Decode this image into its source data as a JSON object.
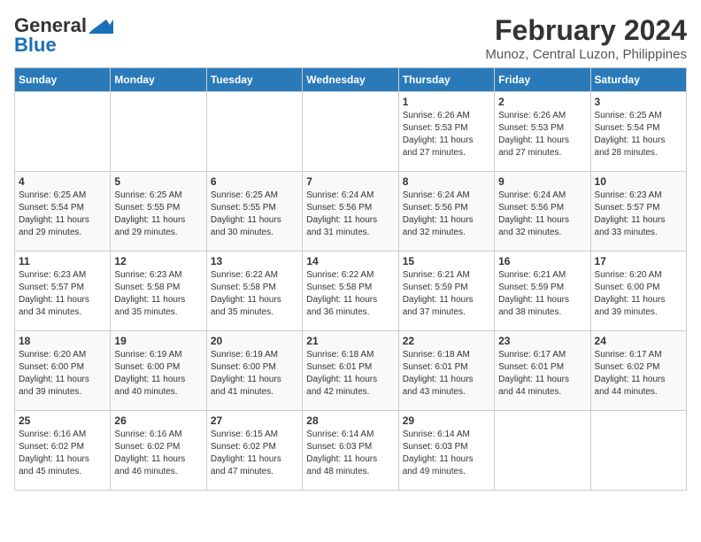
{
  "logo": {
    "line1": "General",
    "line2": "Blue"
  },
  "title": "February 2024",
  "subtitle": "Munoz, Central Luzon, Philippines",
  "days_of_week": [
    "Sunday",
    "Monday",
    "Tuesday",
    "Wednesday",
    "Thursday",
    "Friday",
    "Saturday"
  ],
  "weeks": [
    [
      {
        "day": "",
        "info": ""
      },
      {
        "day": "",
        "info": ""
      },
      {
        "day": "",
        "info": ""
      },
      {
        "day": "",
        "info": ""
      },
      {
        "day": "1",
        "info": "Sunrise: 6:26 AM\nSunset: 5:53 PM\nDaylight: 11 hours\nand 27 minutes."
      },
      {
        "day": "2",
        "info": "Sunrise: 6:26 AM\nSunset: 5:53 PM\nDaylight: 11 hours\nand 27 minutes."
      },
      {
        "day": "3",
        "info": "Sunrise: 6:25 AM\nSunset: 5:54 PM\nDaylight: 11 hours\nand 28 minutes."
      }
    ],
    [
      {
        "day": "4",
        "info": "Sunrise: 6:25 AM\nSunset: 5:54 PM\nDaylight: 11 hours\nand 29 minutes."
      },
      {
        "day": "5",
        "info": "Sunrise: 6:25 AM\nSunset: 5:55 PM\nDaylight: 11 hours\nand 29 minutes."
      },
      {
        "day": "6",
        "info": "Sunrise: 6:25 AM\nSunset: 5:55 PM\nDaylight: 11 hours\nand 30 minutes."
      },
      {
        "day": "7",
        "info": "Sunrise: 6:24 AM\nSunset: 5:56 PM\nDaylight: 11 hours\nand 31 minutes."
      },
      {
        "day": "8",
        "info": "Sunrise: 6:24 AM\nSunset: 5:56 PM\nDaylight: 11 hours\nand 32 minutes."
      },
      {
        "day": "9",
        "info": "Sunrise: 6:24 AM\nSunset: 5:56 PM\nDaylight: 11 hours\nand 32 minutes."
      },
      {
        "day": "10",
        "info": "Sunrise: 6:23 AM\nSunset: 5:57 PM\nDaylight: 11 hours\nand 33 minutes."
      }
    ],
    [
      {
        "day": "11",
        "info": "Sunrise: 6:23 AM\nSunset: 5:57 PM\nDaylight: 11 hours\nand 34 minutes."
      },
      {
        "day": "12",
        "info": "Sunrise: 6:23 AM\nSunset: 5:58 PM\nDaylight: 11 hours\nand 35 minutes."
      },
      {
        "day": "13",
        "info": "Sunrise: 6:22 AM\nSunset: 5:58 PM\nDaylight: 11 hours\nand 35 minutes."
      },
      {
        "day": "14",
        "info": "Sunrise: 6:22 AM\nSunset: 5:58 PM\nDaylight: 11 hours\nand 36 minutes."
      },
      {
        "day": "15",
        "info": "Sunrise: 6:21 AM\nSunset: 5:59 PM\nDaylight: 11 hours\nand 37 minutes."
      },
      {
        "day": "16",
        "info": "Sunrise: 6:21 AM\nSunset: 5:59 PM\nDaylight: 11 hours\nand 38 minutes."
      },
      {
        "day": "17",
        "info": "Sunrise: 6:20 AM\nSunset: 6:00 PM\nDaylight: 11 hours\nand 39 minutes."
      }
    ],
    [
      {
        "day": "18",
        "info": "Sunrise: 6:20 AM\nSunset: 6:00 PM\nDaylight: 11 hours\nand 39 minutes."
      },
      {
        "day": "19",
        "info": "Sunrise: 6:19 AM\nSunset: 6:00 PM\nDaylight: 11 hours\nand 40 minutes."
      },
      {
        "day": "20",
        "info": "Sunrise: 6:19 AM\nSunset: 6:00 PM\nDaylight: 11 hours\nand 41 minutes."
      },
      {
        "day": "21",
        "info": "Sunrise: 6:18 AM\nSunset: 6:01 PM\nDaylight: 11 hours\nand 42 minutes."
      },
      {
        "day": "22",
        "info": "Sunrise: 6:18 AM\nSunset: 6:01 PM\nDaylight: 11 hours\nand 43 minutes."
      },
      {
        "day": "23",
        "info": "Sunrise: 6:17 AM\nSunset: 6:01 PM\nDaylight: 11 hours\nand 44 minutes."
      },
      {
        "day": "24",
        "info": "Sunrise: 6:17 AM\nSunset: 6:02 PM\nDaylight: 11 hours\nand 44 minutes."
      }
    ],
    [
      {
        "day": "25",
        "info": "Sunrise: 6:16 AM\nSunset: 6:02 PM\nDaylight: 11 hours\nand 45 minutes."
      },
      {
        "day": "26",
        "info": "Sunrise: 6:16 AM\nSunset: 6:02 PM\nDaylight: 11 hours\nand 46 minutes."
      },
      {
        "day": "27",
        "info": "Sunrise: 6:15 AM\nSunset: 6:02 PM\nDaylight: 11 hours\nand 47 minutes."
      },
      {
        "day": "28",
        "info": "Sunrise: 6:14 AM\nSunset: 6:03 PM\nDaylight: 11 hours\nand 48 minutes."
      },
      {
        "day": "29",
        "info": "Sunrise: 6:14 AM\nSunset: 6:03 PM\nDaylight: 11 hours\nand 49 minutes."
      },
      {
        "day": "",
        "info": ""
      },
      {
        "day": "",
        "info": ""
      }
    ]
  ]
}
